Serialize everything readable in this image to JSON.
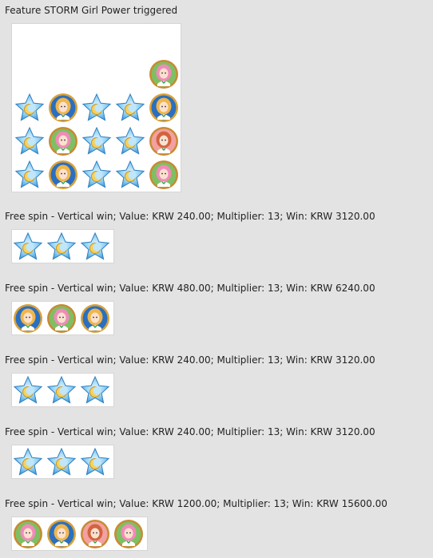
{
  "feature": {
    "title": "Feature STORM Girl Power triggered",
    "grid": [
      [
        "",
        "",
        "",
        "",
        "pink"
      ],
      [
        "star",
        "blonde",
        "star",
        "star",
        "blonde"
      ],
      [
        "star",
        "pink",
        "star",
        "star",
        "red"
      ],
      [
        "star",
        "blonde",
        "star",
        "star",
        "pink"
      ]
    ]
  },
  "wins": [
    {
      "text": "Free spin - Vertical win; Value: KRW 240.00; Multiplier: 13; Win: KRW 3120.00",
      "symbols": [
        "star",
        "star",
        "star"
      ]
    },
    {
      "text": "Free spin - Vertical win; Value: KRW 480.00; Multiplier: 13; Win: KRW 6240.00",
      "symbols": [
        "blonde",
        "pink",
        "blonde"
      ]
    },
    {
      "text": "Free spin - Vertical win; Value: KRW 240.00; Multiplier: 13; Win: KRW 3120.00",
      "symbols": [
        "star",
        "star",
        "star"
      ]
    },
    {
      "text": "Free spin - Vertical win; Value: KRW 240.00; Multiplier: 13; Win: KRW 3120.00",
      "symbols": [
        "star",
        "star",
        "star"
      ]
    },
    {
      "text": "Free spin - Vertical win; Value: KRW 1200.00; Multiplier: 13; Win: KRW 15600.00",
      "symbols": [
        "pink",
        "blonde",
        "red",
        "pink"
      ]
    }
  ],
  "symbol_icons": {
    "star": "moon-star-icon",
    "blonde": "blonde-girl-icon",
    "pink": "pink-girl-icon",
    "red": "red-girl-icon"
  }
}
